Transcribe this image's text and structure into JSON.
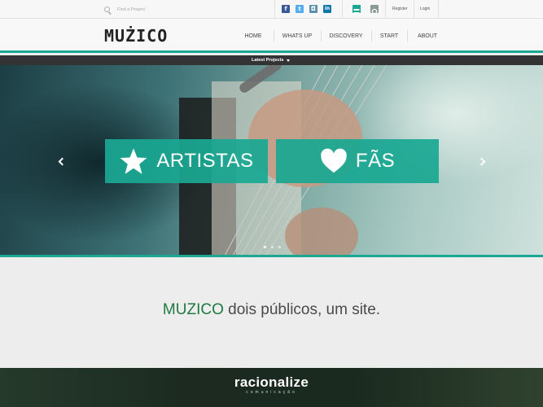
{
  "topbar": {
    "search_placeholder": "Find a Project",
    "social_icons": [
      {
        "name": "facebook-icon",
        "glyph": "f",
        "color": "#3b5998"
      },
      {
        "name": "twitter-icon",
        "glyph": "t",
        "color": "#55acee"
      },
      {
        "name": "instagram-icon",
        "glyph": "◘",
        "color": "#5b8fb0"
      },
      {
        "name": "linkedin-icon",
        "glyph": "in",
        "color": "#0e76a8"
      }
    ],
    "tool_icons": [
      {
        "name": "stack-icon",
        "color": "#1aa892"
      },
      {
        "name": "settings-icon",
        "color": "#8a9a96"
      }
    ],
    "register_label": "Register",
    "login_label": "Login"
  },
  "header": {
    "logo_text": "MUŻICO",
    "nav": [
      "HOME",
      "WHATS UP",
      "DISCOVERY",
      "START",
      "ABOUT"
    ],
    "active_nav": "HOME"
  },
  "latest": {
    "label": "Latest Projects"
  },
  "hero": {
    "buttons": [
      {
        "label": "ARTISTAS",
        "icon": "star-icon"
      },
      {
        "label": "FÃS",
        "icon": "heart-icon"
      }
    ],
    "slide_count": 3,
    "active_slide": 1
  },
  "tagline": {
    "brand": "MUZICO",
    "text": " dois públicos, um site."
  },
  "footer": {
    "logo": "racionalize",
    "subtitle": "comunicação"
  },
  "colors": {
    "accent": "#1aa892",
    "tagline_brand": "#1e7a43",
    "strip_dark": "#333333"
  }
}
